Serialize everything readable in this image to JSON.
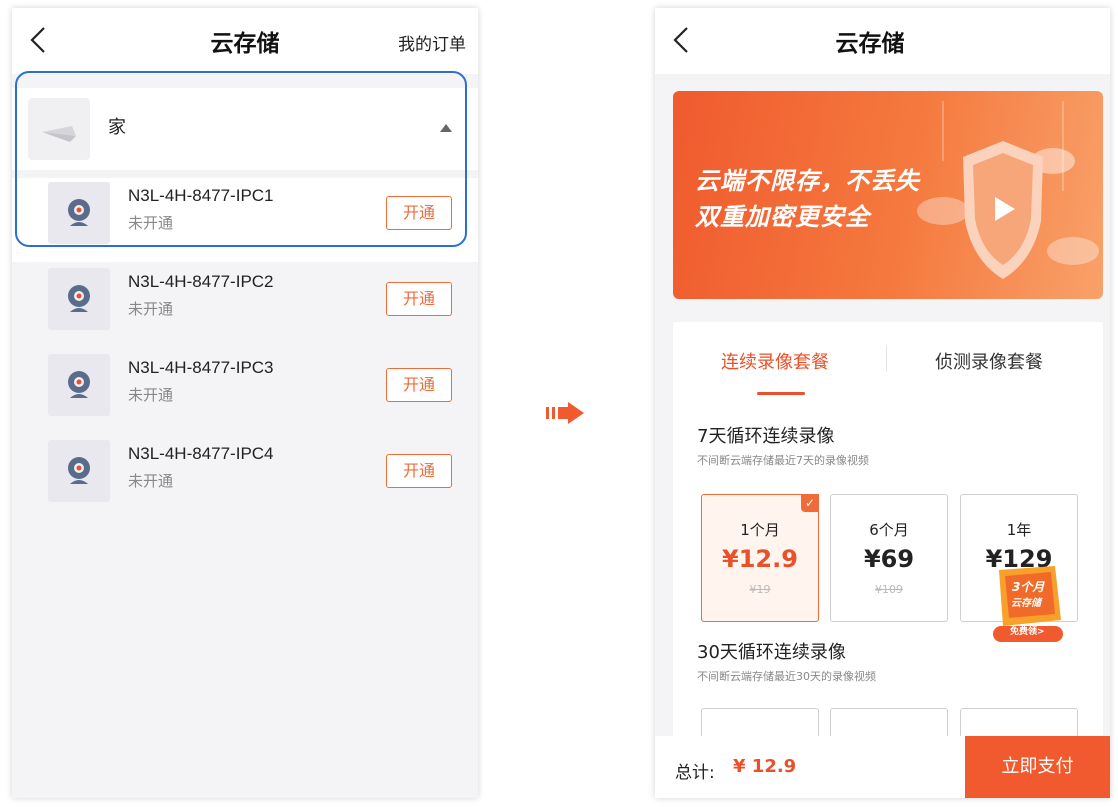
{
  "left": {
    "header": {
      "title": "云存储",
      "orders_link": "我的订单"
    },
    "group": {
      "name": "家"
    },
    "devices": [
      {
        "name": "N3L-4H-8477-IPC1",
        "status": "未开通",
        "button": "开通"
      },
      {
        "name": "N3L-4H-8477-IPC2",
        "status": "未开通",
        "button": "开通"
      },
      {
        "name": "N3L-4H-8477-IPC3",
        "status": "未开通",
        "button": "开通"
      },
      {
        "name": "N3L-4H-8477-IPC4",
        "status": "未开通",
        "button": "开通"
      }
    ]
  },
  "right": {
    "header": {
      "title": "云存储"
    },
    "banner": {
      "line1": "云端不限存，不丢失",
      "line2": "双重加密更安全"
    },
    "tabs": [
      {
        "label": "连续录像套餐",
        "active": true
      },
      {
        "label": "侦测录像套餐",
        "active": false
      }
    ],
    "plan7": {
      "title": "7天循环连续录像",
      "desc": "不间断云端存储最近7天的录像视频",
      "options": [
        {
          "period": "1个月",
          "price": "¥12.9",
          "old": "¥19",
          "selected": true
        },
        {
          "period": "6个月",
          "price": "¥69",
          "old": "¥109",
          "selected": false
        },
        {
          "period": "1年",
          "price": "¥129",
          "old": "",
          "selected": false
        }
      ],
      "check_mark": "✓"
    },
    "badge": {
      "line1": "3个月",
      "line2": "云存储",
      "line3": "免费领>"
    },
    "plan30": {
      "title": "30天循环连续录像",
      "desc": "不间断云端存储最近30天的录像视频"
    },
    "footer": {
      "total_label": "总计:",
      "total_value": "¥ 12.9",
      "pay_button": "立即支付"
    }
  },
  "colors": {
    "accent": "#f05a2e",
    "highlight": "#2b6fd4",
    "status_gray": "#888888"
  },
  "icons": [
    "back-chevron-icon",
    "caret-up-icon",
    "camera-icon",
    "checkmark-icon",
    "arrow-right-icon",
    "shield-icon"
  ]
}
